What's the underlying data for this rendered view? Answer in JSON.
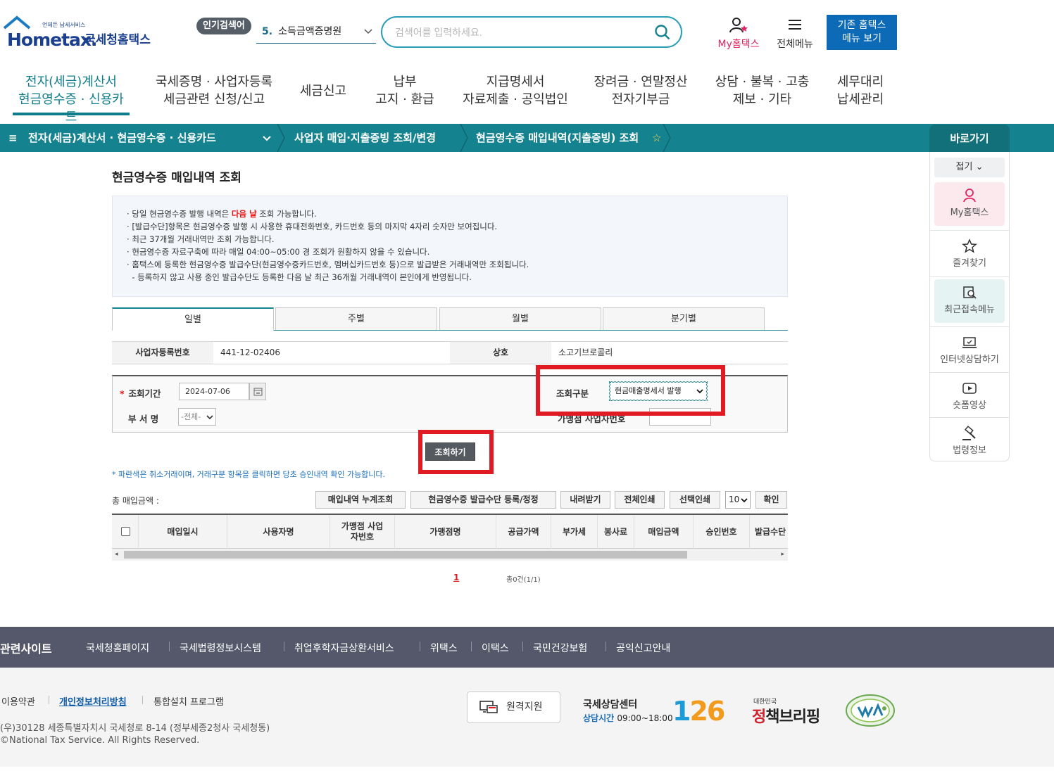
{
  "header": {
    "logo_small": "언제든 납세서비스",
    "logo_brand": "Hometax.",
    "logo_kr": "국세청홈택스",
    "popular_badge": "인기검색어",
    "popular_rank": "5.",
    "popular_term": "소득금액증명원",
    "search_placeholder": "검색어를 입력하세요.",
    "my_hometax": "My홈택스",
    "all_menu": "전체메뉴",
    "old_menu_line1": "기존 홈택스",
    "old_menu_line2": "메뉴 보기"
  },
  "gnb": [
    {
      "l1": "전자(세금)계산서",
      "l2": "현금영수증 · 신용카드"
    },
    {
      "l1": "국세증명 · 사업자등록",
      "l2": "세금관련 신청/신고"
    },
    {
      "l1": "세금신고",
      "l2": ""
    },
    {
      "l1": "납부",
      "l2": "고지 · 환급"
    },
    {
      "l1": "지급명세서",
      "l2": "자료제출 · 공익법인"
    },
    {
      "l1": "장려금 · 연말정산",
      "l2": "전자기부금"
    },
    {
      "l1": "상담 · 불복 · 고충",
      "l2": "제보 · 기타"
    },
    {
      "l1": "세무대리",
      "l2": "납세관리"
    }
  ],
  "breadcrumb": {
    "menu_glyph": "≡",
    "level1": "전자(세금)계산서 · 현금영수증 · 신용카드",
    "level2": "사업자 매입·지출증빙 조회/변경",
    "level3": "현금영수증 매입내역(지출증빙) 조회",
    "star": "☆"
  },
  "quick": {
    "title": "바로가기",
    "fold": "접기 ⌄",
    "items": [
      "My홈택스",
      "즐겨찾기",
      "최근접속메뉴",
      "인터넷상담하기",
      "숏폼영상",
      "법령정보"
    ]
  },
  "page_title": "현금영수증 매입내역 조회",
  "info": {
    "l1_pre": "당일 현금영수증 발행 내역은 ",
    "l1_hl": "다음 날",
    "l1_post": " 조회 가능합니다.",
    "l2": "[발급수단]항목은 현금영수증 발행 시 사용한 휴대전화번호, 카드번호 등의 마지막 4자리 숫자만 보여집니다.",
    "l3": "최근 37개월 거래내역만 조회 가능합니다.",
    "l4": "현금영수증 자료구축에 따라 매일 04:00~05:00 경 조회가 원활하지 않을 수 있습니다.",
    "l5": "홈택스에 등록한 현금영수증 발급수단(현금영수증카드번호, 멤버십카드번호 등)으로 발급받은 거래내역만 조회됩니다.",
    "l6": "- 등록하지 않고 사용 중인 발급수단도 등록한 다음 날 최근 36개월 거래내역이 본인에게 반영됩니다."
  },
  "tabs": [
    "일별",
    "주별",
    "월별",
    "분기별"
  ],
  "biz": {
    "reg_label": "사업자등록번호",
    "reg_value": "441-12-02406",
    "name_label": "상호",
    "name_value": "소고기브로콜리"
  },
  "form": {
    "required_mark": "*",
    "period_label": "조회기간",
    "date_value": "2024-07-06",
    "dept_label": "부 서 명",
    "dept_value": "-전체-",
    "type_label": "조회구분",
    "type_value": "현금매출명세서 발행",
    "store_label": "가맹점 사업자번호",
    "query_button": "조회하기"
  },
  "note": "* 파란색은 취소거래이며, 거래구분 항목을 클릭하면 당초 승인내역 확인 가능합니다.",
  "toolbar": {
    "total_label": "총 매입금액 :",
    "buttons": [
      "매입내역 누계조회",
      "현금영수증 발급수단 등록/정정",
      "내려받기",
      "전체인쇄",
      "선택인쇄"
    ],
    "page_size": "10",
    "confirm": "확인"
  },
  "grid": {
    "columns": [
      "매입일시",
      "사용자명",
      "가맹점 사업자번호",
      "가맹점명",
      "공급가액",
      "부가세",
      "봉사료",
      "매입금액",
      "승인번호",
      "발급수단"
    ]
  },
  "pager": {
    "current": "1",
    "total": "총0건(1/1)"
  },
  "footer": {
    "related_title": "관련사이트",
    "related_links": [
      "국세청홈페이지",
      "국세법령정보시스템",
      "취업후학자금상환서비스",
      "위택스",
      "이택스",
      "국민건강보험",
      "공익신고안내"
    ],
    "links": [
      "이용약관",
      "개인정보처리방침",
      "통합설치 프로그램"
    ],
    "address": "(우)30128 세종특별자치시 국세청로 8-14 (정부세종2청사 국세청동)",
    "copyright": "©National Tax Service. All Rights Reserved.",
    "remote": "원격지원",
    "center_title": "국세상담센터",
    "center_hours_label": "상담시간",
    "center_hours": "09:00~18:00",
    "center_number_1": "1",
    "center_number_rest": "26",
    "briefing_small": "대한민국",
    "briefing_a": "정",
    "briefing_b": "책",
    "briefing_c": "브리핑"
  },
  "colors": {
    "teal": "#15838f",
    "highlight_red": "#e01b24",
    "brand_blue": "#1a3f8f"
  }
}
